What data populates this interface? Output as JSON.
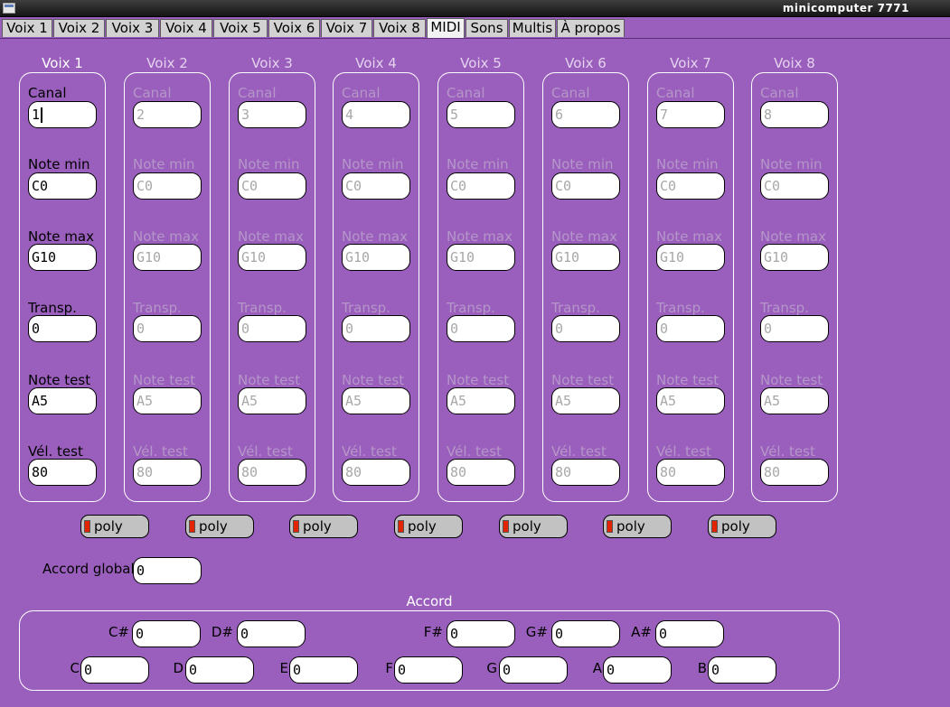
{
  "window": {
    "title": "minicomputer 7771"
  },
  "tabs": [
    {
      "label": "Voix 1",
      "active": false
    },
    {
      "label": "Voix 2",
      "active": false
    },
    {
      "label": "Voix 3",
      "active": false
    },
    {
      "label": "Voix 4",
      "active": false
    },
    {
      "label": "Voix 5",
      "active": false
    },
    {
      "label": "Voix 6",
      "active": false
    },
    {
      "label": "Voix 7",
      "active": false
    },
    {
      "label": "Voix 8",
      "active": false
    },
    {
      "label": "MIDI",
      "active": true
    },
    {
      "label": "Sons",
      "active": false
    },
    {
      "label": "Multis",
      "active": false
    },
    {
      "label": "À propos",
      "active": false
    }
  ],
  "voices": [
    {
      "title": "Voix 1",
      "enabled": true,
      "fields": [
        {
          "label": "Canal",
          "value": "1",
          "focused": true
        },
        {
          "label": "Note min",
          "value": "C0"
        },
        {
          "label": "Note max",
          "value": "G10"
        },
        {
          "label": "Transp.",
          "value": "0"
        },
        {
          "label": "Note test",
          "value": "A5"
        },
        {
          "label": "Vél. test",
          "value": "80"
        }
      ]
    },
    {
      "title": "Voix 2",
      "enabled": false,
      "fields": [
        {
          "label": "Canal",
          "value": "2"
        },
        {
          "label": "Note min",
          "value": "C0"
        },
        {
          "label": "Note max",
          "value": "G10"
        },
        {
          "label": "Transp.",
          "value": "0"
        },
        {
          "label": "Note test",
          "value": "A5"
        },
        {
          "label": "Vél. test",
          "value": "80"
        }
      ]
    },
    {
      "title": "Voix 3",
      "enabled": false,
      "fields": [
        {
          "label": "Canal",
          "value": "3"
        },
        {
          "label": "Note min",
          "value": "C0"
        },
        {
          "label": "Note max",
          "value": "G10"
        },
        {
          "label": "Transp.",
          "value": "0"
        },
        {
          "label": "Note test",
          "value": "A5"
        },
        {
          "label": "Vél. test",
          "value": "80"
        }
      ]
    },
    {
      "title": "Voix 4",
      "enabled": false,
      "fields": [
        {
          "label": "Canal",
          "value": "4"
        },
        {
          "label": "Note min",
          "value": "C0"
        },
        {
          "label": "Note max",
          "value": "G10"
        },
        {
          "label": "Transp.",
          "value": "0"
        },
        {
          "label": "Note test",
          "value": "A5"
        },
        {
          "label": "Vél. test",
          "value": "80"
        }
      ]
    },
    {
      "title": "Voix 5",
      "enabled": false,
      "fields": [
        {
          "label": "Canal",
          "value": "5"
        },
        {
          "label": "Note min",
          "value": "C0"
        },
        {
          "label": "Note max",
          "value": "G10"
        },
        {
          "label": "Transp.",
          "value": "0"
        },
        {
          "label": "Note test",
          "value": "A5"
        },
        {
          "label": "Vél. test",
          "value": "80"
        }
      ]
    },
    {
      "title": "Voix 6",
      "enabled": false,
      "fields": [
        {
          "label": "Canal",
          "value": "6"
        },
        {
          "label": "Note min",
          "value": "C0"
        },
        {
          "label": "Note max",
          "value": "G10"
        },
        {
          "label": "Transp.",
          "value": "0"
        },
        {
          "label": "Note test",
          "value": "A5"
        },
        {
          "label": "Vél. test",
          "value": "80"
        }
      ]
    },
    {
      "title": "Voix 7",
      "enabled": false,
      "fields": [
        {
          "label": "Canal",
          "value": "7"
        },
        {
          "label": "Note min",
          "value": "C0"
        },
        {
          "label": "Note max",
          "value": "G10"
        },
        {
          "label": "Transp.",
          "value": "0"
        },
        {
          "label": "Note test",
          "value": "A5"
        },
        {
          "label": "Vél. test",
          "value": "80"
        }
      ]
    },
    {
      "title": "Voix 8",
      "enabled": false,
      "fields": [
        {
          "label": "Canal",
          "value": "8"
        },
        {
          "label": "Note min",
          "value": "C0"
        },
        {
          "label": "Note max",
          "value": "G10"
        },
        {
          "label": "Transp.",
          "value": "0"
        },
        {
          "label": "Note test",
          "value": "A5"
        },
        {
          "label": "Vél. test",
          "value": "80"
        }
      ]
    }
  ],
  "poly_toggles": [
    {
      "label": "poly",
      "led_color": "#e32400"
    },
    {
      "label": "poly",
      "led_color": "#e32400"
    },
    {
      "label": "poly",
      "led_color": "#e32400"
    },
    {
      "label": "poly",
      "led_color": "#e32400"
    },
    {
      "label": "poly",
      "led_color": "#e32400"
    },
    {
      "label": "poly",
      "led_color": "#e32400"
    },
    {
      "label": "poly",
      "led_color": "#e32400"
    }
  ],
  "global_chord": {
    "label": "Accord global",
    "value": "0"
  },
  "chord": {
    "title": "Accord",
    "notes": [
      {
        "label": "C#",
        "value": "0"
      },
      {
        "label": "D#",
        "value": "0"
      },
      {
        "label": "F#",
        "value": "0"
      },
      {
        "label": "G#",
        "value": "0"
      },
      {
        "label": "A#",
        "value": "0"
      },
      {
        "label": "C",
        "value": "0"
      },
      {
        "label": "D",
        "value": "0"
      },
      {
        "label": "E",
        "value": "0"
      },
      {
        "label": "F",
        "value": "0"
      },
      {
        "label": "G",
        "value": "0"
      },
      {
        "label": "A",
        "value": "0"
      },
      {
        "label": "B",
        "value": "0"
      }
    ]
  },
  "colors": {
    "background": "#9a5fbd",
    "led": "#e32400",
    "tab": "#d2d2d2",
    "tab_active": "#f2f2f2"
  }
}
